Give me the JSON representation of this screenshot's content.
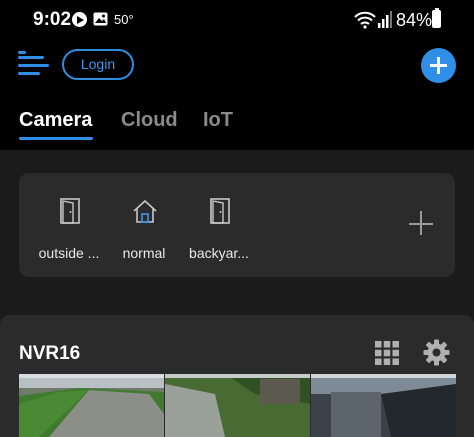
{
  "status_bar": {
    "time": "9:02",
    "temperature": "50°",
    "battery_percent": "84%",
    "icons": [
      "play-icon",
      "photo-icon",
      "wifi-icon",
      "signal-icon",
      "battery-icon"
    ]
  },
  "header": {
    "login_label": "Login",
    "menu_icon": "menu-icon",
    "add_icon": "plus-icon",
    "accent_color": "#2f8fe6",
    "notification_color": "#ee4b4b"
  },
  "tabs": [
    {
      "label": "Camera",
      "active": true
    },
    {
      "label": "Cloud",
      "active": false
    },
    {
      "label": "IoT",
      "active": false
    }
  ],
  "scenes": [
    {
      "label": "outside ...",
      "icon": "door-icon"
    },
    {
      "label": "normal",
      "icon": "home-icon"
    },
    {
      "label": "backyar...",
      "icon": "door-icon"
    }
  ],
  "nvr": {
    "title": "NVR16",
    "grid_icon": "grid-icon",
    "settings_icon": "gear-icon"
  },
  "camera_thumbnails": [
    "camera-feed-1",
    "camera-feed-2",
    "camera-feed-3"
  ]
}
